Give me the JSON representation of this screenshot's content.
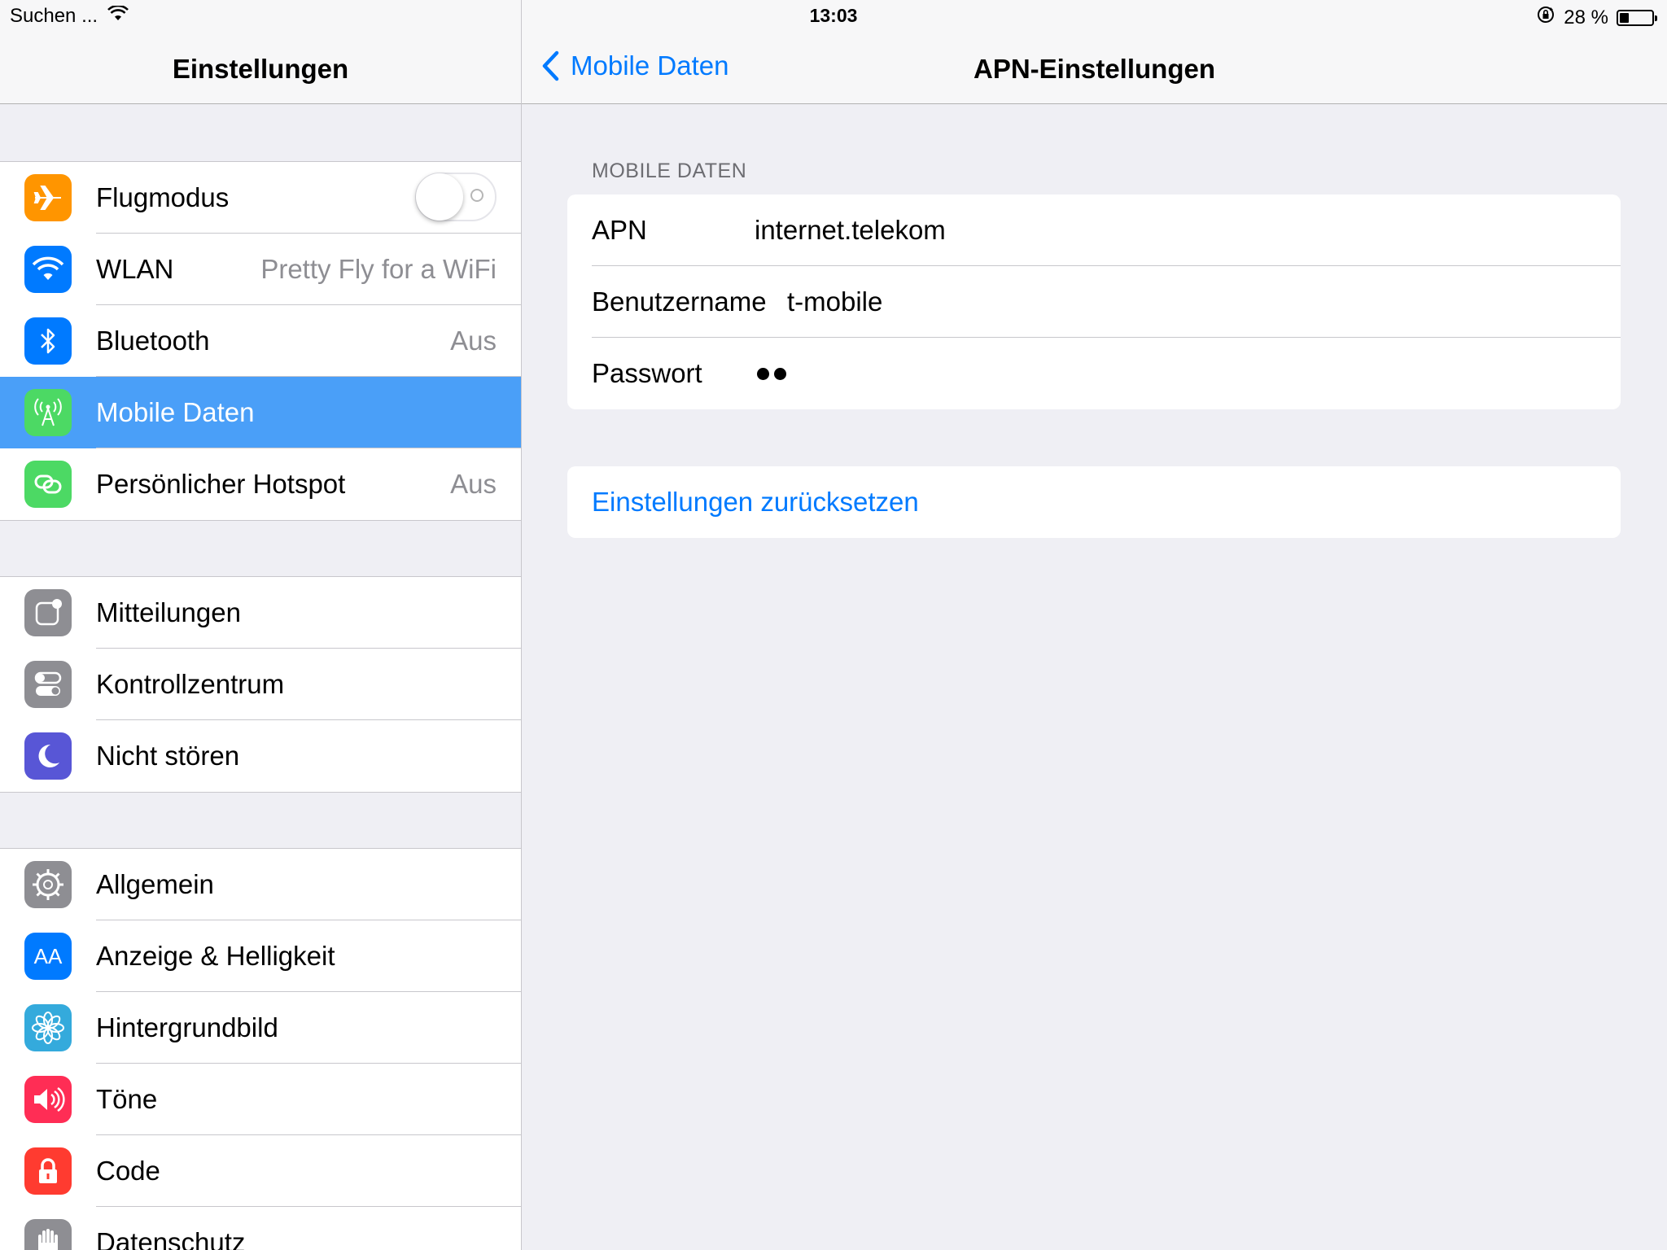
{
  "status_bar": {
    "left_text": "Suchen ...",
    "time": "13:03",
    "battery_text": "28 %",
    "battery_level": 0.28
  },
  "sidebar": {
    "title": "Einstellungen",
    "groups": [
      [
        {
          "label": "Flugmodus",
          "icon": "airplane-icon",
          "color": "#ff9500",
          "toggle": false
        },
        {
          "label": "WLAN",
          "icon": "wifi-icon",
          "color": "#007aff",
          "detail": "Pretty Fly for a WiFi"
        },
        {
          "label": "Bluetooth",
          "icon": "bluetooth-icon",
          "color": "#007aff",
          "detail": "Aus"
        },
        {
          "label": "Mobile Daten",
          "icon": "antenna-icon",
          "color": "#4cd964",
          "selected": true
        },
        {
          "label": "Persönlicher Hotspot",
          "icon": "hotspot-icon",
          "color": "#4cd964",
          "detail": "Aus"
        }
      ],
      [
        {
          "label": "Mitteilungen",
          "icon": "notifications-icon",
          "color": "#8e8e93"
        },
        {
          "label": "Kontrollzentrum",
          "icon": "control-center-icon",
          "color": "#8e8e93"
        },
        {
          "label": "Nicht stören",
          "icon": "moon-icon",
          "color": "#5856d6"
        }
      ],
      [
        {
          "label": "Allgemein",
          "icon": "gear-icon",
          "color": "#8e8e93"
        },
        {
          "label": "Anzeige & Helligkeit",
          "icon": "text-size-icon",
          "color": "#007aff",
          "icon_text": "AA"
        },
        {
          "label": "Hintergrundbild",
          "icon": "wallpaper-flower-icon",
          "color": "#34aadc"
        },
        {
          "label": "Töne",
          "icon": "speaker-icon",
          "color": "#ff2d55"
        },
        {
          "label": "Code",
          "icon": "lock-icon",
          "color": "#ff3b30"
        },
        {
          "label": "Datenschutz",
          "icon": "hand-icon",
          "color": "#8e8e93"
        }
      ]
    ]
  },
  "detail": {
    "back_label": "Mobile Daten",
    "title": "APN-Einstellungen",
    "section_header": "MOBILE DATEN",
    "fields": [
      {
        "label": "APN",
        "value": "internet.telekom"
      },
      {
        "label": "Benutzername",
        "value": "t-mobile"
      },
      {
        "label": "Passwort",
        "value_dots": 2
      }
    ],
    "reset_label": "Einstellungen zurücksetzen"
  }
}
